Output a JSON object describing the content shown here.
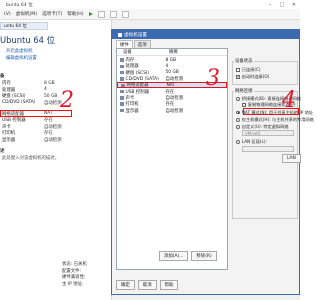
{
  "window": {
    "title": "buntu 64 位",
    "menu_items": [
      "(V)",
      "虚拟机(M)",
      "选项卡(T)",
      "帮助(H)"
    ]
  },
  "left": {
    "tab_label": "untu 64 位",
    "vm_title": "Ubuntu 64 位",
    "links": [
      "开启此虚拟机",
      "编辑虚拟机设置"
    ],
    "section_hardware": "备",
    "hardware_rows": [
      {
        "name": "内存",
        "value": "8 GB"
      },
      {
        "name": "处理器",
        "value": "4"
      },
      {
        "name": "硬盘 (SCSI)",
        "value": "50 GB"
      },
      {
        "name": "CD/DVD (SATA)",
        "value": "自动检测"
      },
      {
        "name": "网络适配器",
        "value": "NAT"
      },
      {
        "name": "USB 控制器",
        "value": "存在"
      },
      {
        "name": "声卡",
        "value": "自动检测"
      },
      {
        "name": "打印机",
        "value": "存在"
      },
      {
        "name": "显示器",
        "value": "自动检测"
      }
    ],
    "section_desc": "述",
    "desc_text": "此处键入对该虚拟机的描述。"
  },
  "dialog": {
    "title": "虚拟机设置",
    "tabs": [
      "硬件",
      "选项"
    ],
    "columns": [
      "设备",
      "摘要"
    ],
    "devices": [
      {
        "name": "内存",
        "summary": "8 GB"
      },
      {
        "name": "处理器",
        "summary": "4"
      },
      {
        "name": "硬盘 (SCSI)",
        "summary": "50 GB"
      },
      {
        "name": "CD/DVD (SATA)",
        "summary": "自动检测"
      },
      {
        "name": "网络适配器",
        "summary": "NAT"
      },
      {
        "name": "USB 控制器",
        "summary": "存在"
      },
      {
        "name": "声卡",
        "summary": "自动检测"
      },
      {
        "name": "打印机",
        "summary": "存在"
      },
      {
        "name": "显示器",
        "summary": "自动检测"
      }
    ],
    "add_button": "添加(A)...",
    "remove_button": "移除(R)",
    "ok_button": "确定",
    "cancel_button": "取消",
    "help_button": "帮助",
    "device_status_label": "设备状态",
    "connected_label": "已连接(C)",
    "connect_at_power_on": "启动时连接(O)",
    "network_connection_label": "网络连接",
    "bridged": "桥接模式(B): 直接连接物理网络",
    "replicate": "复制物理网络连接状态(P)",
    "nat": "NAT 模式(N): 用于共享主机的 IP 地址",
    "host_only": "仅主机模式(H): 与主机共享的专用网络",
    "custom": "自定义(U): 特定虚拟网络",
    "custom_select": "VMnet0",
    "lan_segment": "LAN 区段(L):",
    "advanced_button": "LAN"
  },
  "annotations": [
    "2",
    "3",
    "4"
  ],
  "below_list": [
    "状态: 已关机",
    "配置文件:",
    "硬件兼容性:",
    "主 IP 地址:"
  ]
}
